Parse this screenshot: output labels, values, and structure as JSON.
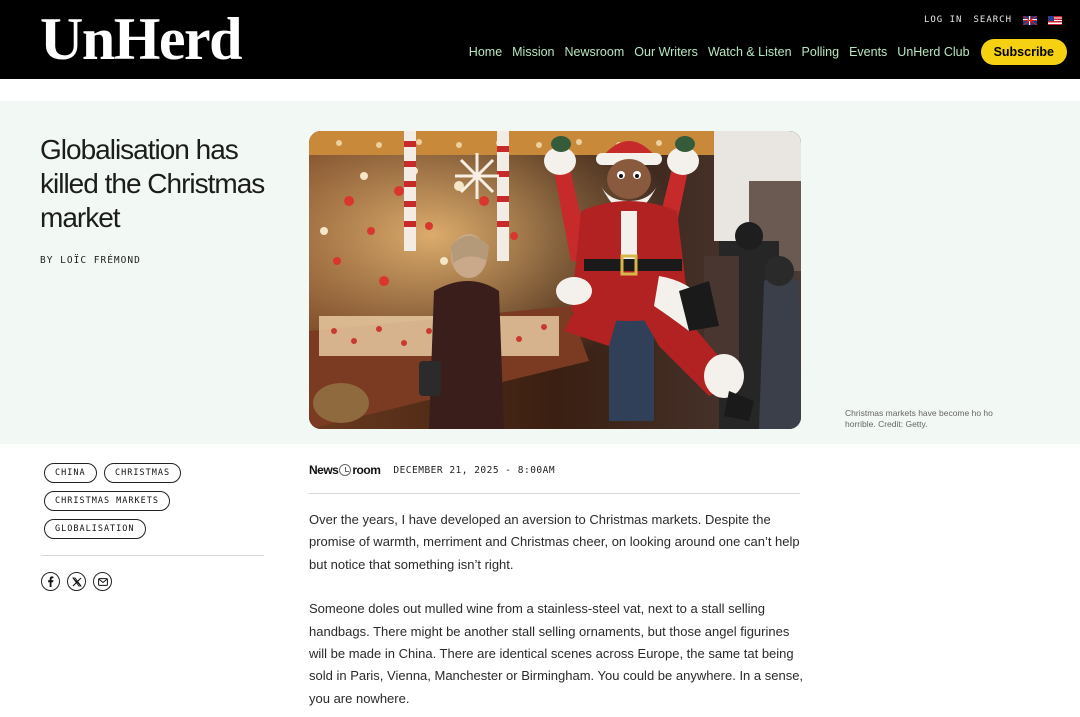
{
  "header": {
    "logo": "UnHerd",
    "utility": {
      "login": "LOG IN",
      "search": "SEARCH"
    },
    "flags": [
      "uk-flag-icon",
      "us-flag-icon"
    ],
    "nav": [
      "Home",
      "Mission",
      "Newsroom",
      "Our Writers",
      "Watch & Listen",
      "Polling",
      "Events",
      "UnHerd Club"
    ],
    "subscribe": "Subscribe",
    "colors": {
      "background": "#000000",
      "nav_text": "#b8e6c0",
      "subscribe_bg": "#f5d112"
    }
  },
  "article": {
    "title": "Globalisation has killed the Christmas market",
    "byline": "BY LOÏC FRÉMOND",
    "caption": "Christmas markets have become ho ho horrible. Credit: Getty.",
    "section": {
      "before": "News",
      "after": "room"
    },
    "date": "DECEMBER 21, 2025 - 8:00AM",
    "tags": [
      "CHINA",
      "CHRISTMAS",
      "CHRISTMAS MARKETS",
      "GLOBALISATION"
    ],
    "share": [
      "facebook-icon",
      "x-icon",
      "email-icon"
    ],
    "paragraphs": [
      "Over the years, I have developed an aversion to Christmas markets. Despite the promise of warmth, merriment and Christmas cheer, on looking around one can’t help but notice that something isn’t right.",
      "Someone doles out mulled wine from a stainless-steel vat, next to a stall selling handbags. There might be another stall selling ornaments, but those angel figurines will be made in China. There are identical scenes across Europe, the same tat being sold in Paris, Vienna, Manchester or Birmingham. You could be anywhere. In a sense, you are nowhere."
    ]
  }
}
